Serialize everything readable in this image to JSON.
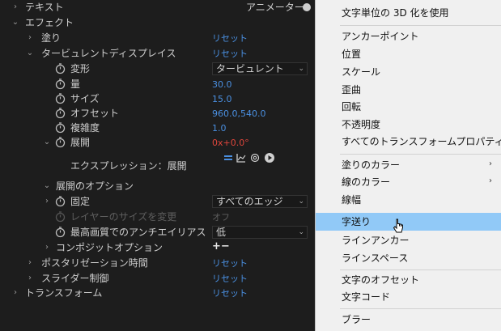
{
  "panel": {
    "rows": [
      {
        "label": "テキスト",
        "value": "アニメーター："
      },
      {
        "label": "エフェクト"
      },
      {
        "label": "塗り",
        "value": "リセット"
      },
      {
        "label": "タービュレントディスプレイス",
        "value": "リセット"
      },
      {
        "label": "変形",
        "value": "タービュレント"
      },
      {
        "label": "量",
        "value": "30.0"
      },
      {
        "label": "サイズ",
        "value": "15.0"
      },
      {
        "label": "オフセット",
        "value": "960.0,540.0"
      },
      {
        "label": "複雑度",
        "value": "1.0"
      },
      {
        "label": "展開",
        "value": "0x+0.0°"
      },
      {
        "label": "エクスプレッション：展開"
      },
      {
        "label": "展開のオプション"
      },
      {
        "label": "固定",
        "value": "すべてのエッジ"
      },
      {
        "label": "レイヤーのサイズを変更",
        "value": "オフ"
      },
      {
        "label": "最高画質でのアンチエイリアス",
        "value": "低"
      },
      {
        "label": "コンポジットオプション",
        "value": "+−"
      },
      {
        "label": "ポスタリゼーション時間",
        "value": "リセット"
      },
      {
        "label": "スライダー制御",
        "value": "リセット"
      },
      {
        "label": "トランスフォーム",
        "value": "リセット"
      }
    ]
  },
  "expression_icons": [
    "equals-icon",
    "graph-icon",
    "spiral-icon",
    "play-icon"
  ],
  "menu": {
    "items": [
      {
        "label": "文字単位の 3D 化を使用"
      },
      {
        "label": "アンカーポイント"
      },
      {
        "label": "位置"
      },
      {
        "label": "スケール"
      },
      {
        "label": "歪曲"
      },
      {
        "label": "回転"
      },
      {
        "label": "不透明度"
      },
      {
        "label": "すべてのトランスフォームプロパティ"
      },
      {
        "label": "塗りのカラー",
        "submenu": true,
        "arrow": "›"
      },
      {
        "label": "線のカラー",
        "submenu": true,
        "arrow": "›"
      },
      {
        "label": "線幅"
      },
      {
        "label": "字送り",
        "highlighted": true
      },
      {
        "label": "ラインアンカー"
      },
      {
        "label": "ラインスペース"
      },
      {
        "label": "文字のオフセット"
      },
      {
        "label": "文字コード"
      },
      {
        "label": "ブラー"
      }
    ]
  },
  "colors": {
    "panel_bg": "#1d1d1d",
    "link_blue": "#4a8fe0",
    "keyframed_red": "#e0463c",
    "menu_bg": "#f0f0f0",
    "menu_highlight": "#91c9f7"
  }
}
